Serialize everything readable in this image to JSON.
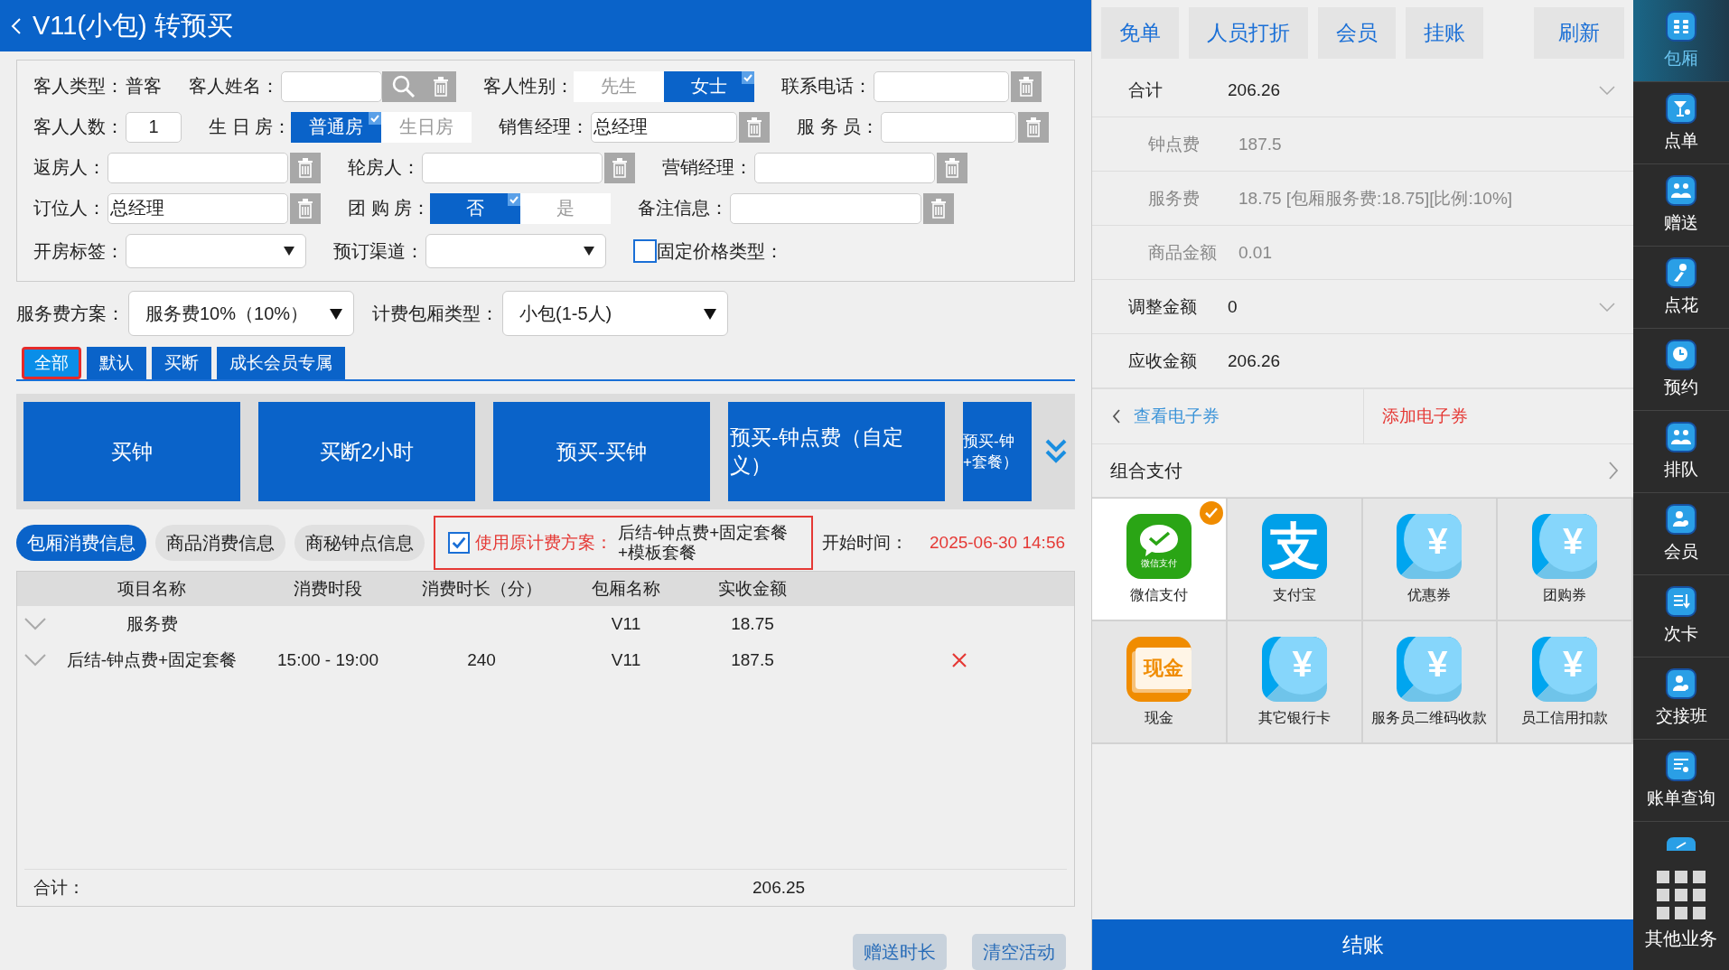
{
  "header": {
    "title": "V11(小包) 转预买"
  },
  "form": {
    "rows": [
      [
        {
          "kind": "static",
          "label": "客人类型：",
          "value": "普客"
        },
        {
          "kind": "input",
          "label": "客人姓名：",
          "search": true,
          "trash": true
        },
        {
          "kind": "toggle",
          "label": "客人性别：",
          "options": [
            {
              "label": "先生",
              "selected": false
            },
            {
              "label": "女士",
              "selected": true
            }
          ]
        },
        {
          "kind": "input",
          "label": "联系电话：",
          "trash": true
        }
      ],
      [
        {
          "kind": "input",
          "label": "客人人数：",
          "value": "1",
          "center": true
        },
        {
          "kind": "toggle",
          "label": "生 日 房：",
          "options": [
            {
              "label": "普通房",
              "selected": true
            },
            {
              "label": "生日房",
              "selected": false
            }
          ]
        },
        {
          "kind": "input",
          "label": "销售经理：",
          "value": "总经理",
          "trash": true
        },
        {
          "kind": "input",
          "label": "服 务 员：",
          "trash": true
        }
      ],
      [
        {
          "kind": "input",
          "label": "返房人：",
          "trash": true
        },
        {
          "kind": "input",
          "label": "轮房人：",
          "trash": true
        },
        {
          "kind": "input",
          "label": "营销经理：",
          "trash": true
        }
      ],
      [
        {
          "kind": "input",
          "label": "订位人：",
          "value": "总经理",
          "trash": true
        },
        {
          "kind": "toggle",
          "label": "团 购 房：",
          "options": [
            {
              "label": "否",
              "selected": true
            },
            {
              "label": "是",
              "selected": false
            }
          ]
        },
        {
          "kind": "input",
          "label": "备注信息：",
          "trash": true
        }
      ],
      [
        {
          "kind": "select",
          "label": "开房标签："
        },
        {
          "kind": "select",
          "label": "预订渠道："
        },
        {
          "kind": "checkbox",
          "label": "固定价格类型：",
          "checked": false
        }
      ]
    ]
  },
  "fee": [
    {
      "label": "服务费方案：",
      "value": "服务费10%（10%）"
    },
    {
      "label": "计费包厢类型：",
      "value": "小包(1-5人)"
    }
  ],
  "categories": [
    {
      "label": "全部",
      "selected": true
    },
    {
      "label": "默认",
      "selected": false
    },
    {
      "label": "买断",
      "selected": false
    },
    {
      "label": "成长会员专属",
      "selected": false
    }
  ],
  "products": [
    "买钟",
    "买断2小时",
    "预买-买钟",
    "预买-钟点费（自定义）",
    "预买-钟\n+套餐）"
  ],
  "info_tabs": [
    {
      "label": "包厢消费信息",
      "selected": true
    },
    {
      "label": "商品消费信息",
      "selected": false
    },
    {
      "label": "商秘钟点信息",
      "selected": false
    }
  ],
  "original_plan": {
    "checked": true,
    "label": "使用原计费方案：",
    "value": "后结-钟点费+固定套餐+模板套餐"
  },
  "start_time": {
    "label": "开始时间：",
    "value": "2025-06-30 14:56"
  },
  "table": {
    "columns": [
      "项目名称",
      "消费时段",
      "消费时长（分）",
      "包厢名称",
      "实收金额"
    ],
    "rows": [
      {
        "cells": [
          "服务费",
          "",
          "",
          "V11",
          "18.75"
        ],
        "deletable": false
      },
      {
        "cells": [
          "后结-钟点费+固定套餐",
          "15:00 - 19:00",
          "240",
          "V11",
          "187.5"
        ],
        "deletable": true
      }
    ],
    "total_label": "合计：",
    "total": "206.25"
  },
  "bottom_buttons": [
    "赠送时长",
    "清空活动"
  ],
  "right": {
    "top_buttons": [
      "免单",
      "人员打折",
      "会员",
      "挂账",
      "刷新"
    ],
    "summary": [
      {
        "label": "合计",
        "value": "206.26",
        "kind": "main",
        "chevron": true
      },
      {
        "label": "钟点费",
        "value": "187.5",
        "kind": "sub"
      },
      {
        "label": "服务费",
        "value": "18.75 [包厢服务费:18.75][比例:10%]",
        "kind": "sub"
      },
      {
        "label": "商品金额",
        "value": "0.01",
        "kind": "sub"
      },
      {
        "label": "调整金额",
        "value": "0",
        "kind": "main",
        "chevron": true
      },
      {
        "label": "应收金额",
        "value": "206.26",
        "kind": "main",
        "chevron": false
      }
    ],
    "view_coupons": "查看电子券",
    "add_coupon": "添加电子券",
    "combined_pay": "组合支付",
    "payments": [
      {
        "label": "微信支付",
        "kind": "wechat",
        "icon_text": "微信支付",
        "selected": true
      },
      {
        "label": "支付宝",
        "kind": "alipay",
        "icon_text": "支",
        "selected": false
      },
      {
        "label": "优惠券",
        "kind": "yen",
        "icon_text": "¥",
        "selected": false
      },
      {
        "label": "团购券",
        "kind": "yen",
        "icon_text": "¥",
        "selected": false
      },
      {
        "label": "现金",
        "kind": "cash",
        "icon_text": "现金",
        "selected": false
      },
      {
        "label": "其它银行卡",
        "kind": "yen",
        "icon_text": "¥",
        "selected": false
      },
      {
        "label": "服务员二维码收款",
        "kind": "yen",
        "icon_text": "¥",
        "selected": false
      },
      {
        "label": "员工信用扣款",
        "kind": "yen",
        "icon_text": "¥",
        "selected": false
      }
    ],
    "checkout": "结账"
  },
  "sidebar": {
    "items": [
      {
        "label": "包厢",
        "selected": true
      },
      {
        "label": "点单",
        "selected": false
      },
      {
        "label": "赠送",
        "selected": false
      },
      {
        "label": "点花",
        "selected": false
      },
      {
        "label": "预约",
        "selected": false
      },
      {
        "label": "排队",
        "selected": false
      },
      {
        "label": "会员",
        "selected": false
      },
      {
        "label": "次卡",
        "selected": false
      },
      {
        "label": "交接班",
        "selected": false
      },
      {
        "label": "账单查询",
        "selected": false
      }
    ],
    "more": "其他业务"
  }
}
